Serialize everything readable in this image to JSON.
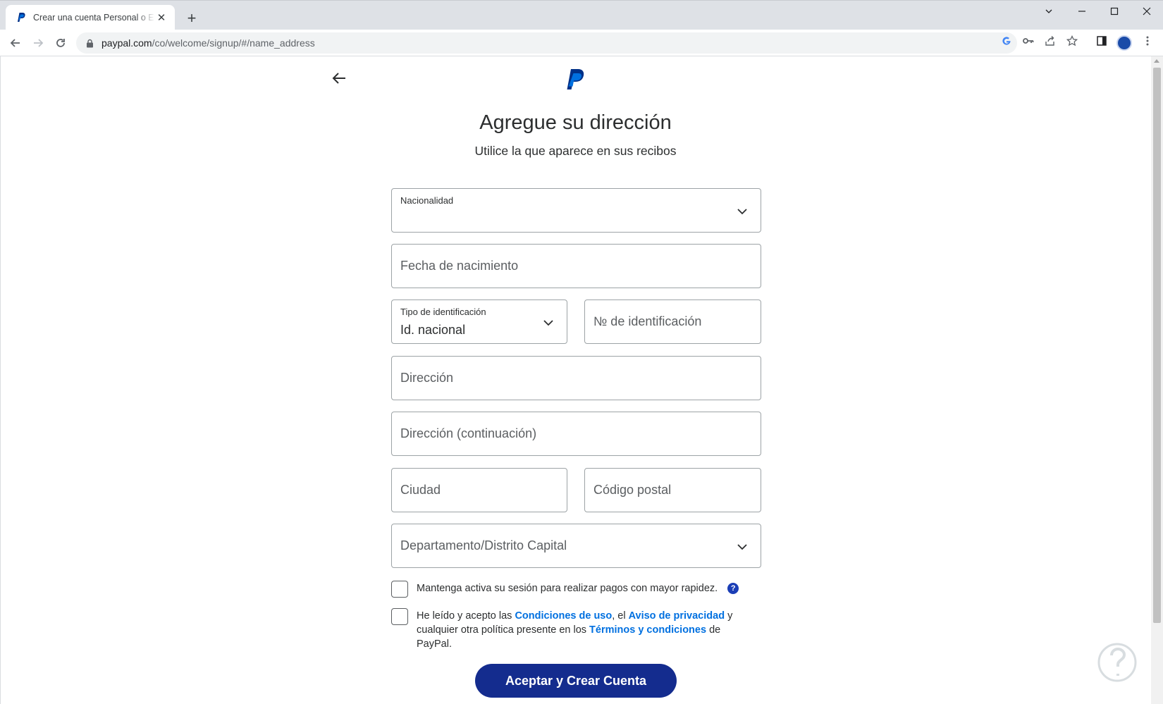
{
  "browser": {
    "tab_title": "Crear una cuenta Personal o Empresa",
    "new_tab": "+",
    "url_host": "paypal.com",
    "url_path": "/co/welcome/signup/#/name_address"
  },
  "page": {
    "title": "Agregue su dirección",
    "subtitle": "Utilice la que aparece en sus recibos"
  },
  "form": {
    "nationality_label": "Nacionalidad",
    "birthdate_placeholder": "Fecha de nacimiento",
    "id_type_label": "Tipo de identificación",
    "id_type_value": "Id. nacional",
    "id_number_placeholder": "№ de identificación",
    "address_placeholder": "Dirección",
    "address2_placeholder": "Dirección (continuación)",
    "city_placeholder": "Ciudad",
    "postal_placeholder": "Código postal",
    "department_placeholder": "Departamento/Distrito Capital"
  },
  "checks": {
    "stay_logged_in": "Mantenga activa su sesión para realizar pagos con mayor rapidez.",
    "help_glyph": "?",
    "terms_part1": "He leído y acepto las ",
    "terms_link1": "Condiciones de uso",
    "terms_part2": ", el ",
    "terms_link2": "Aviso de privacidad",
    "terms_part3": " y cualquier otra política presente en los ",
    "terms_link3": "Términos y condiciones",
    "terms_part4": " de PayPal."
  },
  "cta": {
    "label": "Aceptar y Crear Cuenta"
  },
  "colors": {
    "brand_dark": "#142c8e",
    "link": "#0070e0",
    "help_badge": "#1b3eb6"
  }
}
